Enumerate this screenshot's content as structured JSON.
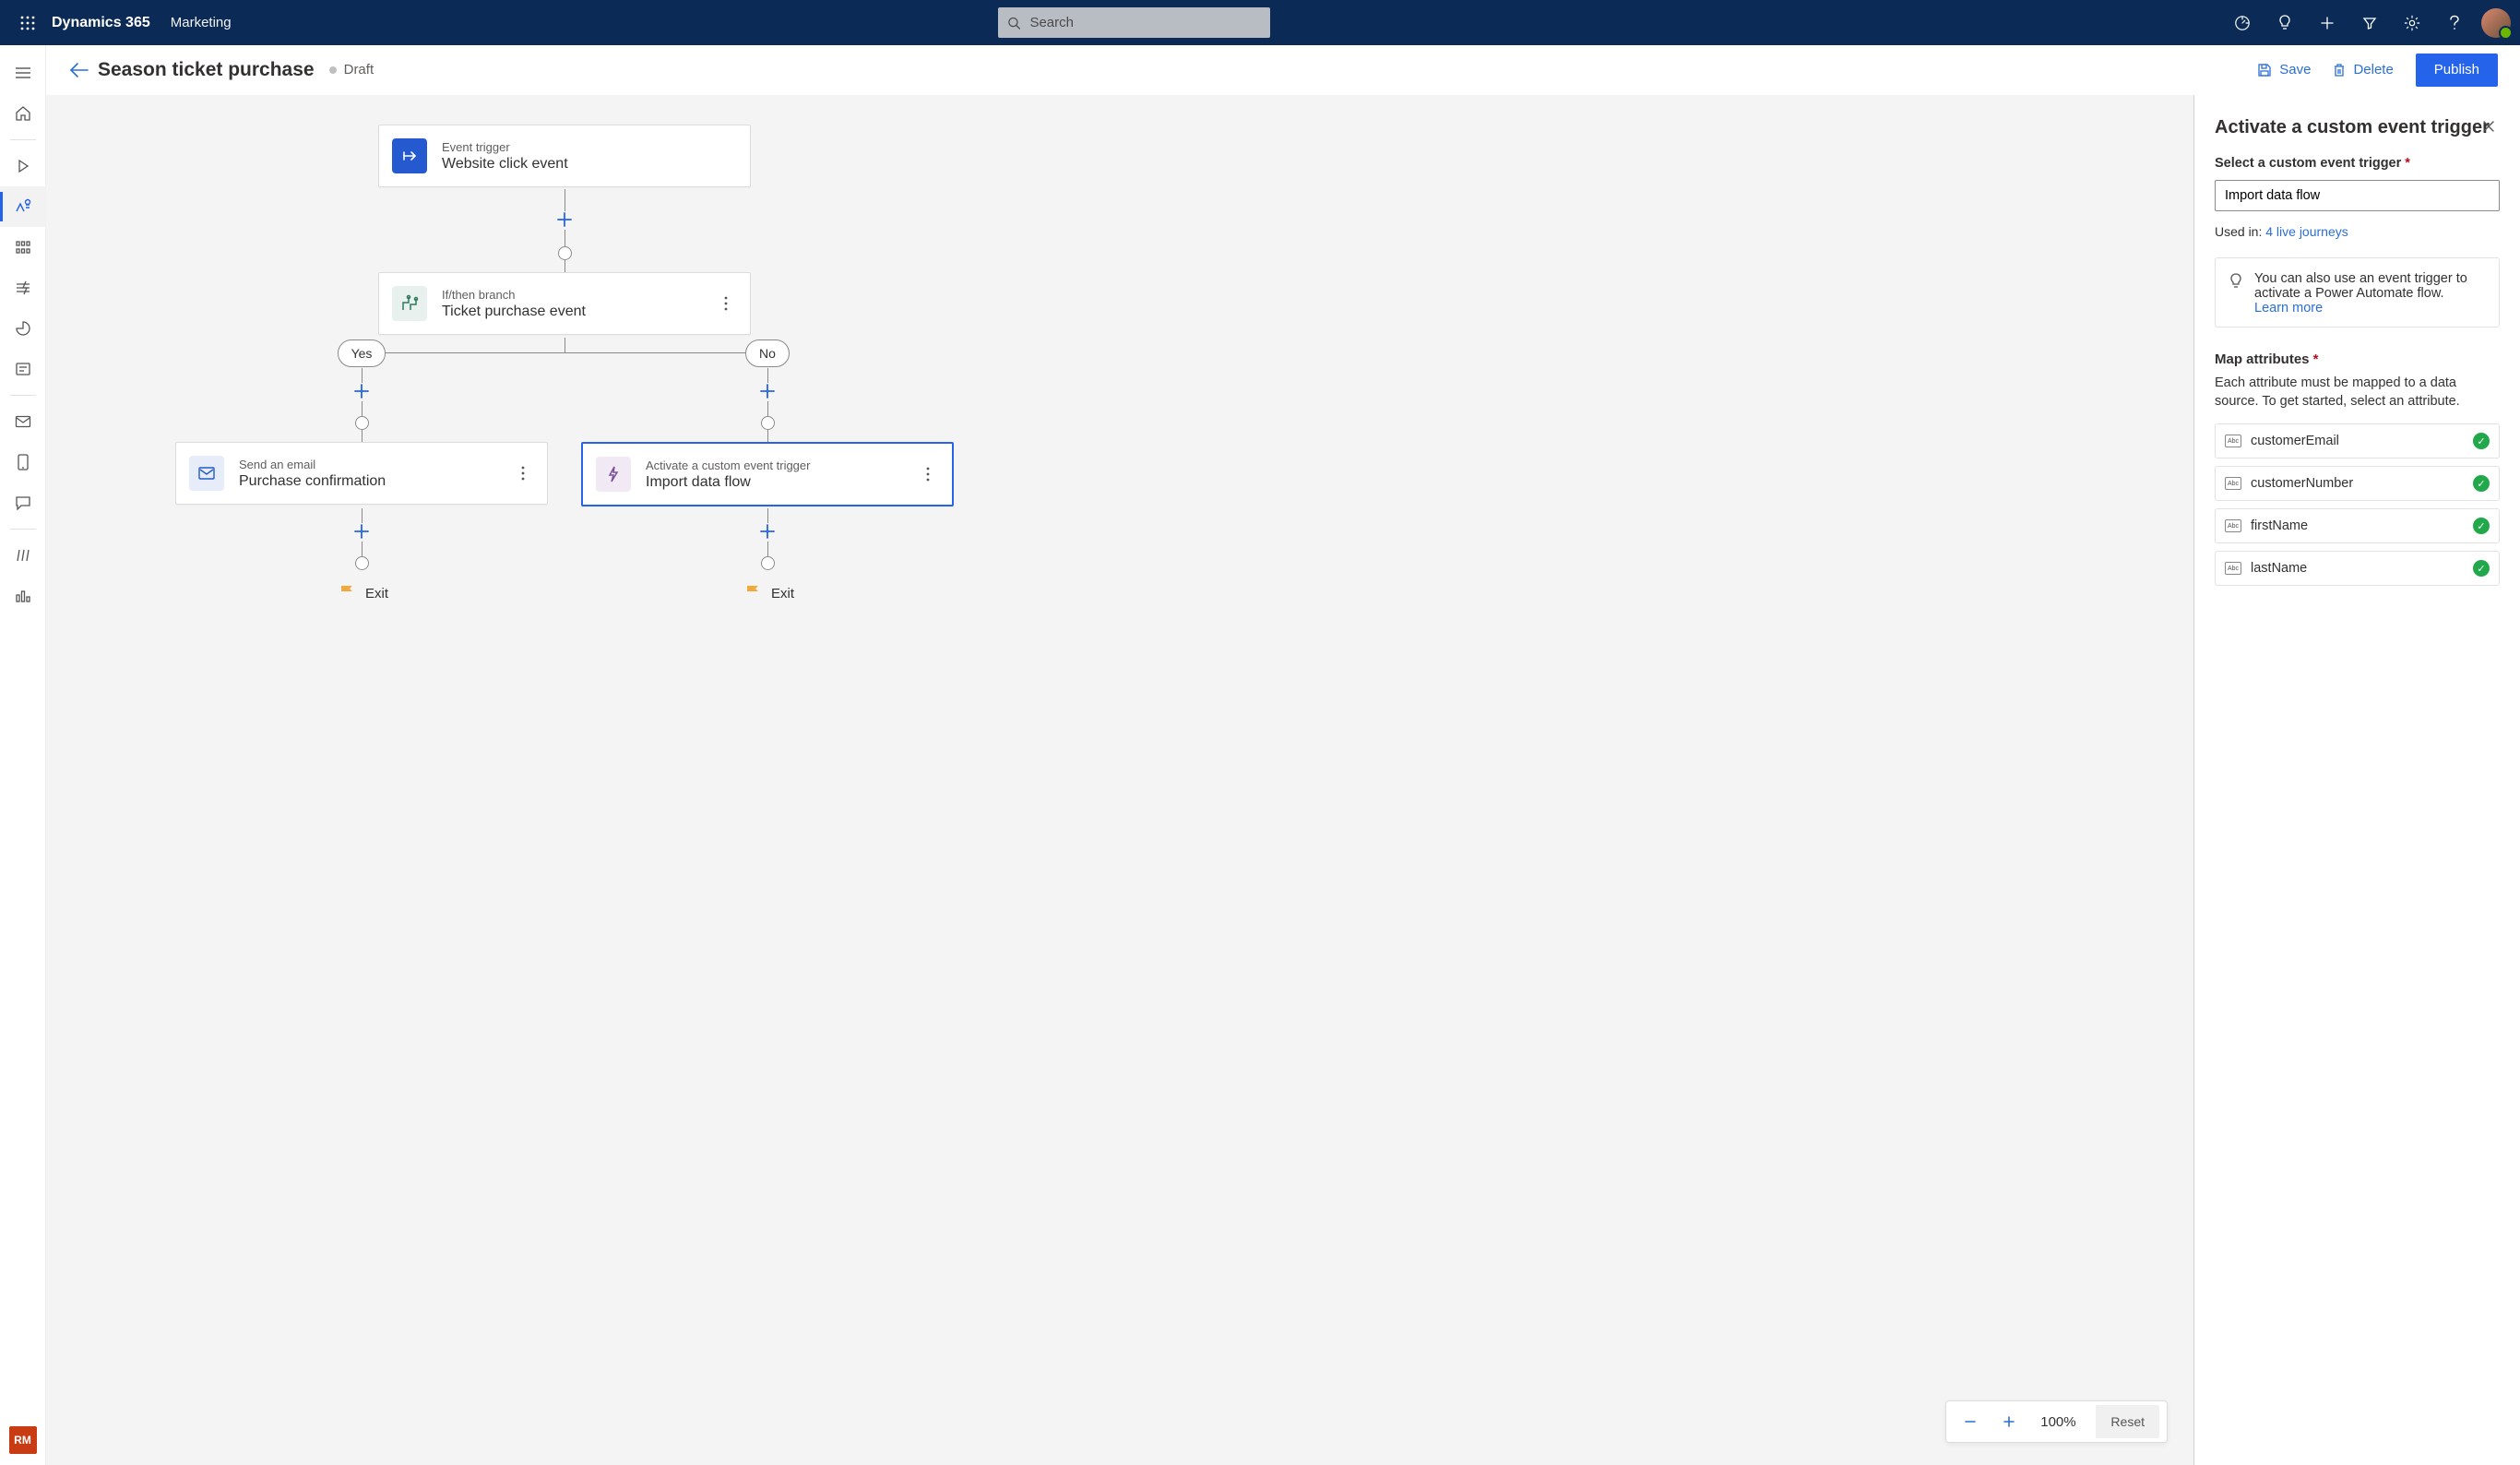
{
  "header": {
    "brand": "Dynamics 365",
    "module": "Marketing",
    "search_placeholder": "Search"
  },
  "page": {
    "title": "Season ticket purchase",
    "status": "Draft",
    "actions": {
      "save": "Save",
      "delete": "Delete",
      "publish": "Publish"
    }
  },
  "flow": {
    "trigger": {
      "kind": "Event trigger",
      "title": "Website click event"
    },
    "branch": {
      "kind": "If/then branch",
      "title": "Ticket purchase event"
    },
    "yes_label": "Yes",
    "no_label": "No",
    "yes_node": {
      "kind": "Send an email",
      "title": "Purchase confirmation"
    },
    "no_node": {
      "kind": "Activate a custom event trigger",
      "title": "Import data flow"
    },
    "exit_label": "Exit"
  },
  "zoom": {
    "value": "100%",
    "reset": "Reset"
  },
  "panel": {
    "title": "Activate a custom event trigger",
    "select_label": "Select a custom event trigger",
    "select_value": "Import data flow",
    "used_in_prefix": "Used in: ",
    "used_in_link": "4 live journeys",
    "tip_text": "You can also use an event trigger to activate a Power Automate flow.",
    "tip_link": "Learn more",
    "map_title": "Map attributes",
    "map_desc": "Each attribute must be mapped to a data source. To get started, select an attribute.",
    "attributes": [
      {
        "name": "customerEmail"
      },
      {
        "name": "customerNumber"
      },
      {
        "name": "firstName"
      },
      {
        "name": "lastName"
      }
    ]
  }
}
